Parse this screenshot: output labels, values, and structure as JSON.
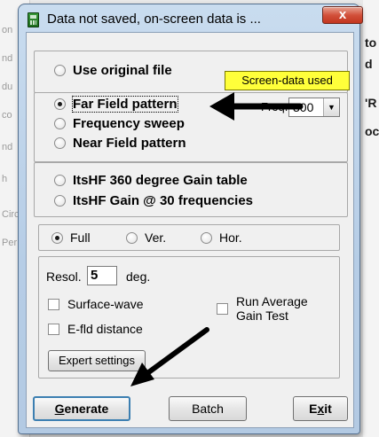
{
  "background": {
    "left_fragments": [
      "on",
      "nd",
      "du",
      "co",
      "nd",
      "h",
      "Circ",
      "Per"
    ],
    "right_fragments": [
      "to",
      "d",
      "'R",
      "oc"
    ]
  },
  "window": {
    "title": "Data not saved, on-screen data is ...",
    "close_label": "x"
  },
  "source_group": {
    "use_original": "Use original file",
    "tooltip": "Screen-data used"
  },
  "pattern_group": {
    "far_field": "Far Field pattern",
    "frequency_sweep": "Frequency sweep",
    "near_field": "Near Field pattern",
    "freq_label": "Freq.:",
    "freq_value": "300",
    "selected": "Far Field pattern"
  },
  "itshf_group": {
    "gain_table": "ItsHF 360 degree Gain table",
    "gain_30": "ItsHF Gain @ 30 frequencies"
  },
  "view_group": {
    "full": "Full",
    "ver": "Ver.",
    "hor": "Hor.",
    "selected": "Full"
  },
  "settings_group": {
    "resol_label": "Resol.",
    "resol_value": "5",
    "deg_label": "deg.",
    "surface_wave": "Surface-wave",
    "efld_distance": "E-fld distance",
    "run_average_line1": "Run Average",
    "run_average_line2": "Gain Test",
    "expert_settings": "Expert settings"
  },
  "buttons": {
    "generate_mnemonic": "G",
    "generate_rest": "enerate",
    "batch": "Batch",
    "exit_prefix": "E",
    "exit_mnemonic": "x",
    "exit_suffix": "it"
  },
  "colors": {
    "tooltip_bg": "#ffff3a",
    "frame": "#b6cde6",
    "close_button": "#c1351e",
    "default_button_border": "#3c7fb1"
  }
}
